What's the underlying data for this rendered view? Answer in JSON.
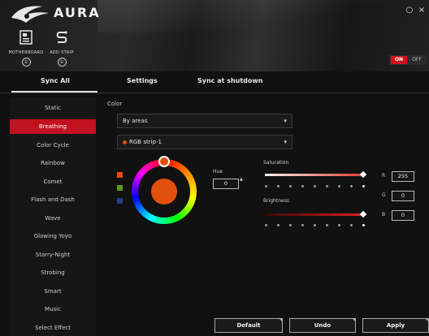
{
  "app": {
    "title": "AURA",
    "window_controls": [
      "○",
      "×"
    ]
  },
  "devices": [
    {
      "label": "MOTHERBOARD",
      "badge": "①",
      "icon": "motherboard-icon"
    },
    {
      "label": "ADD STRIP",
      "badge": "①",
      "icon": "add-strip-icon"
    }
  ],
  "power_toggle": {
    "on_label": "ON",
    "off_label": "OFF",
    "state": "on"
  },
  "tabs": [
    {
      "label": "Sync All",
      "active": true
    },
    {
      "label": "Settings",
      "active": false
    },
    {
      "label": "Sync at shutdown",
      "active": false
    }
  ],
  "effects": [
    {
      "label": "Static",
      "active": false
    },
    {
      "label": "Breathing",
      "active": true
    },
    {
      "label": "Color Cycle",
      "active": false
    },
    {
      "label": "Rainbow",
      "active": false
    },
    {
      "label": "Comet",
      "active": false
    },
    {
      "label": "Flash and Dash",
      "active": false
    },
    {
      "label": "Wave",
      "active": false
    },
    {
      "label": "Glowing Yoyo",
      "active": false
    },
    {
      "label": "Starry-Night",
      "active": false
    },
    {
      "label": "Strobing",
      "active": false
    },
    {
      "label": "Smart",
      "active": false
    },
    {
      "label": "Music",
      "active": false
    },
    {
      "label": "Select Effect",
      "active": false
    }
  ],
  "color_panel": {
    "section_label": "Color",
    "area_select": "By areas",
    "strip_select": "RGB strip-1",
    "swatches": [
      "#e2500e",
      "#5c9a1e",
      "#2a3a8a"
    ],
    "selected_color": "#e2500e",
    "hue_label": "Hue",
    "hue_value": "0",
    "saturation_label": "Saturation",
    "brightness_label": "Brightness",
    "rgb": [
      {
        "label": "R",
        "value": "255"
      },
      {
        "label": "G",
        "value": "0"
      },
      {
        "label": "B",
        "value": "0"
      }
    ]
  },
  "actions": {
    "default": "Default",
    "undo": "Undo",
    "apply": "Apply"
  },
  "colors": {
    "accent": "#c11220",
    "background": "#111111",
    "selected_orange": "#e2500e"
  }
}
